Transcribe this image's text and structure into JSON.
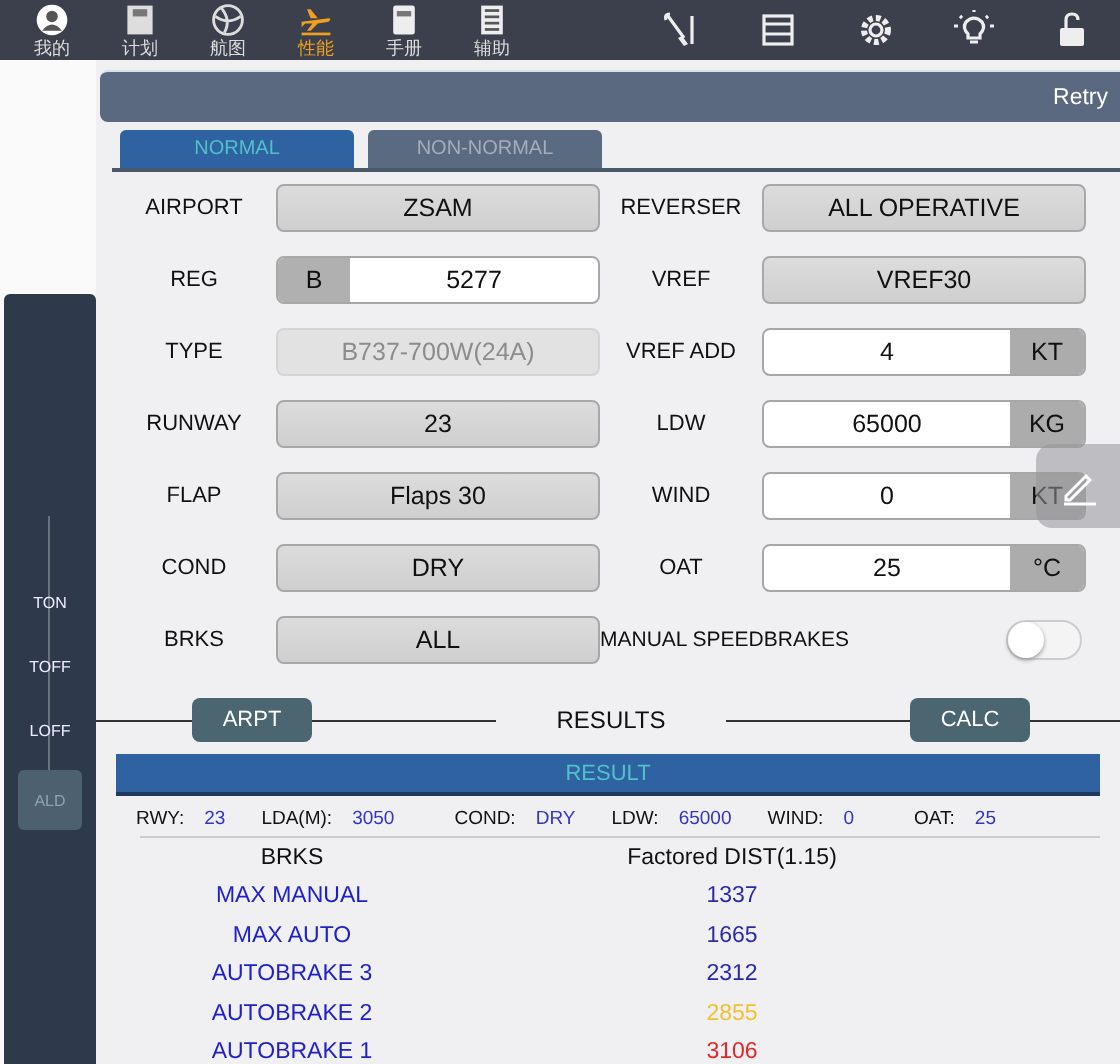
{
  "nav": {
    "items": [
      {
        "label": "我的",
        "selected": false
      },
      {
        "label": "计划",
        "selected": false
      },
      {
        "label": "航图",
        "selected": false
      },
      {
        "label": "性能",
        "selected": true
      },
      {
        "label": "手册",
        "selected": false
      },
      {
        "label": "辅助",
        "selected": false
      }
    ]
  },
  "header": {
    "action": "Retry"
  },
  "side_rail": {
    "items": [
      {
        "label": "TON",
        "selected": false
      },
      {
        "label": "TOFF",
        "selected": false
      },
      {
        "label": "LOFF",
        "selected": false
      },
      {
        "label": "ALD",
        "selected": true
      }
    ]
  },
  "tabs": [
    {
      "label": "NORMAL",
      "selected": true
    },
    {
      "label": "NON-NORMAL",
      "selected": false
    }
  ],
  "form": {
    "rows": [
      {
        "left": {
          "label": "AIRPORT",
          "kind": "select",
          "value": "ZSAM"
        },
        "right": {
          "label": "REVERSER",
          "kind": "select",
          "value": "ALL OPERATIVE"
        }
      },
      {
        "left": {
          "label": "REG",
          "kind": "prefix",
          "prefix": "B",
          "value": "5277"
        },
        "right": {
          "label": "VREF",
          "kind": "select",
          "value": "VREF30"
        }
      },
      {
        "left": {
          "label": "TYPE",
          "kind": "disabled",
          "value": "B737-700W(24A)"
        },
        "right": {
          "label": "VREF ADD",
          "kind": "unit",
          "value": "4",
          "unit": "KT"
        }
      },
      {
        "left": {
          "label": "RUNWAY",
          "kind": "select",
          "value": "23"
        },
        "right": {
          "label": "LDW",
          "kind": "unit",
          "value": "65000",
          "unit": "KG"
        }
      },
      {
        "left": {
          "label": "FLAP",
          "kind": "select",
          "value": "Flaps 30"
        },
        "right": {
          "label": "WIND",
          "kind": "unit",
          "value": "0",
          "unit": "KT"
        }
      },
      {
        "left": {
          "label": "COND",
          "kind": "select",
          "value": "DRY"
        },
        "right": {
          "label": "OAT",
          "kind": "unit",
          "value": "25",
          "unit": "°C"
        }
      },
      {
        "left": {
          "label": "BRKS",
          "kind": "select",
          "value": "ALL"
        },
        "right": {
          "label": "MANUAL SPEEDBRAKES",
          "kind": "toggle",
          "on": false
        }
      }
    ]
  },
  "results": {
    "left_button": "ARPT",
    "title": "RESULTS",
    "right_button": "CALC",
    "bar_title": "RESULT",
    "params": [
      {
        "label": "RWY:",
        "value": "23"
      },
      {
        "label": "LDA(M):",
        "value": "3050"
      },
      {
        "label": "COND:",
        "value": "DRY"
      },
      {
        "label": "LDW:",
        "value": "65000"
      },
      {
        "label": "WIND:",
        "value": "0"
      },
      {
        "label": "OAT:",
        "value": "25"
      }
    ],
    "columns": [
      "BRKS",
      "Factored DIST(1.15)"
    ],
    "rows": [
      {
        "brakes": "MAX MANUAL",
        "distance": "1337",
        "color": "#2a2aa8"
      },
      {
        "brakes": "MAX AUTO",
        "distance": "1665",
        "color": "#2a2aa8"
      },
      {
        "brakes": "AUTOBRAKE 3",
        "distance": "2312",
        "color": "#2a2aa8"
      },
      {
        "brakes": "AUTOBRAKE 2",
        "distance": "2855",
        "color": "#f0c030"
      },
      {
        "brakes": "AUTOBRAKE 1",
        "distance": "3106",
        "color": "#e02828"
      }
    ]
  }
}
